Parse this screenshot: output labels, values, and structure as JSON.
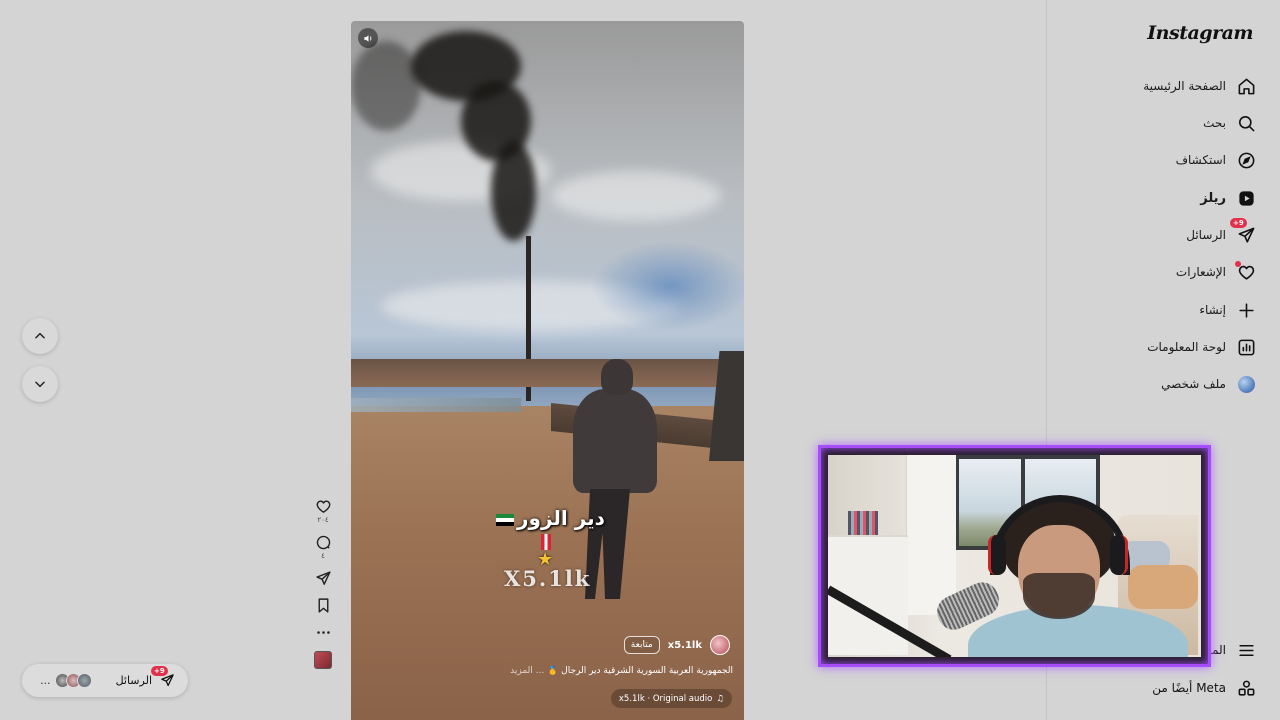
{
  "sidebar": {
    "logo": "Instagram",
    "items": [
      {
        "label": "الصفحة الرئيسية",
        "icon": "home-icon"
      },
      {
        "label": "بحث",
        "icon": "search-icon"
      },
      {
        "label": "استكشاف",
        "icon": "compass-icon"
      },
      {
        "label": "ريلز",
        "icon": "reels-icon",
        "active": true
      },
      {
        "label": "الرسائل",
        "icon": "messenger-icon",
        "badge": "+9"
      },
      {
        "label": "الإشعارات",
        "icon": "heart-icon",
        "dot": true
      },
      {
        "label": "إنشاء",
        "icon": "plus-icon"
      },
      {
        "label": "لوحة المعلومات",
        "icon": "dashboard-icon"
      },
      {
        "label": "ملف شخصي",
        "icon": "profile-avatar"
      }
    ],
    "more_label": "المزيد",
    "meta_label": "أيضًا من Meta"
  },
  "reel": {
    "overlay_city": "دير الزور",
    "watermark": "X5.1lk",
    "username": "x5.1lk",
    "follow_label": "متابعة",
    "caption": "الجمهورية العربية السورية الشرقية دير الرجال 🥇",
    "caption_more": "... المزيد",
    "audio": "x5.1lk · Original audio"
  },
  "rail": {
    "likes": "٢٠٤",
    "comments": "٤"
  },
  "messages_pill": {
    "label": "الرسائل",
    "badge": "+9",
    "more": "..."
  },
  "colors": {
    "accent_badge": "#e0304a",
    "webcam_border": "#a64dff",
    "background": "#d4d4d4"
  }
}
